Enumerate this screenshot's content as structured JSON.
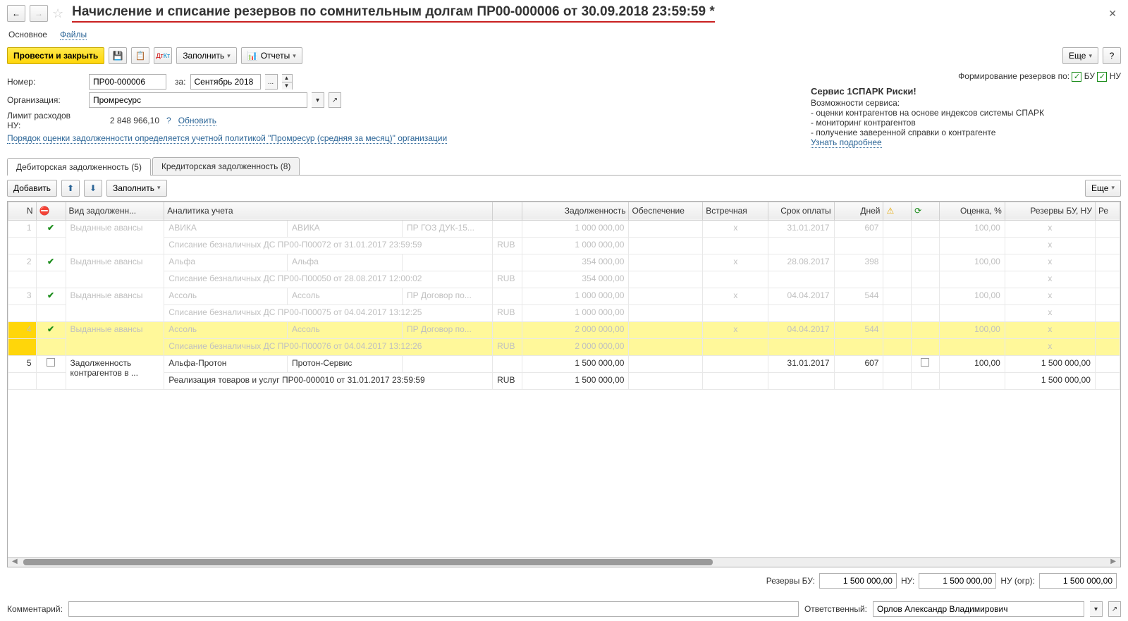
{
  "title": "Начисление и списание резервов по сомнительным долгам ПР00-000006 от 30.09.2018 23:59:59 *",
  "tabs_links": {
    "main": "Основное",
    "files": "Файлы"
  },
  "toolbar": {
    "post_close": "Провести и закрыть",
    "fill": "Заполнить",
    "reports": "Отчеты",
    "more": "Еще",
    "help": "?"
  },
  "form": {
    "number_label": "Номер:",
    "number": "ПР00-000006",
    "period_label": "за:",
    "period": "Сентябрь 2018",
    "period_btn": "...",
    "org_label": "Организация:",
    "org": "Промресурс",
    "limit_label": "Лимит расходов НУ:",
    "limit": "2 848 966,10",
    "limit_q": "?",
    "refresh": "Обновить",
    "policy_text": "Порядок оценки задолженности определяется учетной политикой \"Промресур (средняя за месяц)\" организации",
    "reserve_label": "Формирование резервов по:",
    "bu": "БУ",
    "nu": "НУ"
  },
  "spark": {
    "head": "Сервис 1СПАРК Риски!",
    "sub": "Возможности сервиса:",
    "l1": "- оценки контрагентов на основе индексов системы СПАРК",
    "l2": "- мониторинг контрагентов",
    "l3": "- получение заверенной справки о контрагенте",
    "more": "Узнать подробнее"
  },
  "tabs_main": {
    "debit": "Дебиторская задолженность (5)",
    "credit": "Кредиторская задолженность (8)"
  },
  "sub_toolbar": {
    "add": "Добавить",
    "fill": "Заполнить",
    "more": "Еще"
  },
  "headers": {
    "n": "N",
    "type": "Вид задолженн...",
    "analytics": "Аналитика учета",
    "debt": "Задолженность",
    "secur": "Обеспечение",
    "counter": "Встречная",
    "due": "Срок оплаты",
    "days": "Дней",
    "rate": "Оценка, %",
    "reserves": "Резервы БУ, НУ",
    "re": "Ре"
  },
  "rows": [
    {
      "n": "1",
      "chk": true,
      "faded": true,
      "type": "Выданные авансы",
      "a1": "АВИКА",
      "a2": "АВИКА",
      "a3": "ПР ГОЗ ДУК-15...",
      "debt": "1 000 000,00",
      "counter": "x",
      "due": "31.01.2017",
      "days": "607",
      "rate": "100,00",
      "res": "x",
      "l2a": "Списание безналичных ДС ПР00-П00072 от 31.01.2017 23:59:59",
      "l2cur": "RUB",
      "l2debt": "1 000 000,00",
      "l2res": "x"
    },
    {
      "n": "2",
      "chk": true,
      "faded": true,
      "type": "Выданные авансы",
      "a1": "Альфа",
      "a2": "Альфа",
      "a3": "",
      "debt": "354 000,00",
      "counter": "x",
      "due": "28.08.2017",
      "days": "398",
      "rate": "100,00",
      "res": "x",
      "l2a": "Списание безналичных ДС ПР00-П00050 от 28.08.2017 12:00:02",
      "l2cur": "RUB",
      "l2debt": "354 000,00",
      "l2res": "x"
    },
    {
      "n": "3",
      "chk": true,
      "faded": true,
      "type": "Выданные авансы",
      "a1": "Ассоль",
      "a2": "Ассоль",
      "a3": "ПР Договор по...",
      "debt": "1 000 000,00",
      "counter": "x",
      "due": "04.04.2017",
      "days": "544",
      "rate": "100,00",
      "res": "x",
      "l2a": "Списание безналичных ДС ПР00-П00075 от 04.04.2017 13:12:25",
      "l2cur": "RUB",
      "l2debt": "1 000 000,00",
      "l2res": "x"
    },
    {
      "n": "4",
      "chk": true,
      "faded": true,
      "hl": true,
      "type": "Выданные авансы",
      "a1": "Ассоль",
      "a2": "Ассоль",
      "a3": "ПР Договор по...",
      "debt": "2 000 000,00",
      "counter": "x",
      "due": "04.04.2017",
      "days": "544",
      "rate": "100,00",
      "res": "x",
      "l2a": "Списание безналичных ДС ПР00-П00076 от 04.04.2017 13:12:26",
      "l2cur": "RUB",
      "l2debt": "2 000 000,00",
      "l2res": "x"
    },
    {
      "n": "5",
      "chk": false,
      "faded": false,
      "type": "Задолженность контрагентов в ...",
      "a1": "Альфа-Протон",
      "a2": "Протон-Сервис",
      "a3": "",
      "debt": "1 500 000,00",
      "counter": "",
      "due": "31.01.2017",
      "days": "607",
      "rate": "100,00",
      "res": "1 500 000,00",
      "l2a": "Реализация товаров и услуг ПР00-000010 от 31.01.2017 23:59:59",
      "l2cur": "RUB",
      "l2debt": "1 500 000,00",
      "l2res": "1 500 000,00"
    }
  ],
  "totals": {
    "label_bu": "Резервы БУ:",
    "bu": "1 500 000,00",
    "label_nu": "НУ:",
    "nu": "1 500 000,00",
    "label_ogr": "НУ (огр):",
    "ogr": "1 500 000,00"
  },
  "bottom": {
    "comment_label": "Комментарий:",
    "resp_label": "Ответственный:",
    "resp": "Орлов Александр Владимирович"
  }
}
